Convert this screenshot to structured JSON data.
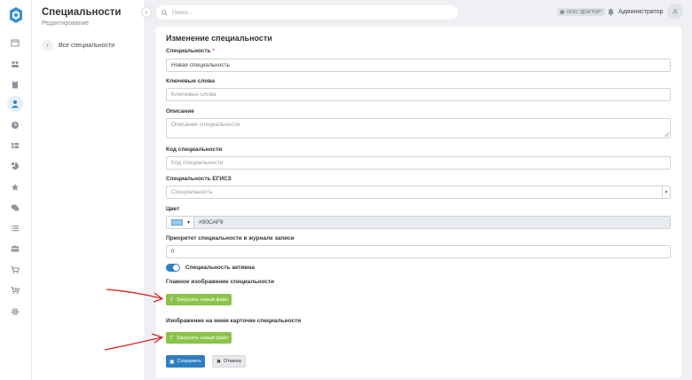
{
  "app": {
    "section_title": "Специальности",
    "section_subtitle": "Редактирование",
    "back_link": "Все специальности"
  },
  "nav": {
    "items": [
      {
        "icon": "calendar-icon"
      },
      {
        "icon": "users-icon"
      },
      {
        "icon": "clipboard-icon"
      },
      {
        "icon": "user-icon",
        "active": true
      },
      {
        "icon": "clock-icon"
      },
      {
        "icon": "table-icon"
      },
      {
        "icon": "pie-chart-icon"
      },
      {
        "icon": "star-icon"
      },
      {
        "icon": "comments-icon"
      },
      {
        "icon": "list-icon"
      },
      {
        "icon": "group-icon"
      },
      {
        "icon": "cart-icon"
      },
      {
        "icon": "cart-plus-icon"
      },
      {
        "icon": "gear-icon"
      }
    ]
  },
  "header": {
    "search_placeholder": "Поиск...",
    "org_badge": "ООО \"ДОКТОР\"",
    "user_name": "Администратор",
    "avatar_letter": "A"
  },
  "form": {
    "title": "Изменение специальности",
    "specialty_label": "Специальность",
    "required_mark": "*",
    "specialty_value": "Новая специальность",
    "keywords_label": "Ключевые слова",
    "keywords_placeholder": "Ключевые слова",
    "description_label": "Описание",
    "description_placeholder": "Описание специальности",
    "code_label": "Код специальности",
    "code_placeholder": "Код специальности",
    "egisz_label": "Специальность ЕГИСЗ",
    "egisz_placeholder": "Специальность",
    "color_label": "Цвет",
    "color_value": "#90CAF9",
    "priority_label": "Приоритет специальности в журнале записи",
    "priority_value": "0",
    "active_label": "Специальность активна",
    "active": true,
    "main_image_label": "Главное изображение специальности",
    "upload_label": "Загрузить новый файл",
    "mini_image_label": "Изображение на мини карточке специальности",
    "upload_label_2": "Загрузить новый файл",
    "save_label": "Сохранить",
    "cancel_label": "Отмена"
  },
  "colors": {
    "accent": "#2f7ec2",
    "upload_button": "#8cc34a",
    "annotation_arrow": "#d9262b",
    "swatch": "#90CAF9"
  }
}
